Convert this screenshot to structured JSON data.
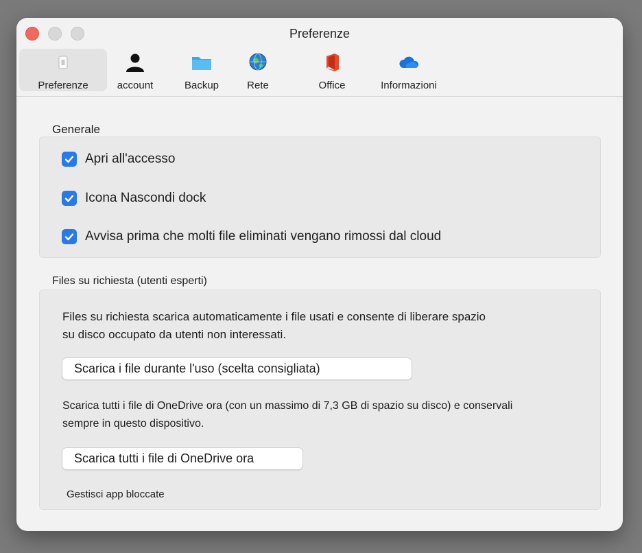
{
  "window": {
    "title": "Preferenze"
  },
  "tabs": [
    {
      "label": "Preferenze",
      "icon": "switch-icon",
      "active": true
    },
    {
      "label": "account",
      "icon": "person-icon"
    },
    {
      "label": "Backup",
      "icon": "folder-icon"
    },
    {
      "label": "Rete",
      "icon": "globe-icon"
    },
    {
      "label": "Office",
      "icon": "office-icon"
    },
    {
      "label": "Informazioni",
      "icon": "cloud-icon"
    }
  ],
  "general": {
    "title": "Generale",
    "options": [
      {
        "label": "Apri all'accesso",
        "checked": true
      },
      {
        "label": "Icona Nascondi dock",
        "checked": true
      },
      {
        "label": "Avvisa prima che molti file eliminati vengano rimossi dal cloud",
        "checked": true
      }
    ]
  },
  "files_on_demand": {
    "title": "Files su richiesta (utenti esperti)",
    "description_line1": "Files su richiesta scarica automaticamente i file usati e consente di liberare spazio",
    "description_line2": "su disco occupato da utenti non interessati.",
    "download_on_use_button": "Scarica i file durante l'uso (scelta consigliata)",
    "download_all_description_line1": "Scarica tutti i file di OneDrive ora (con un massimo di 7,3 GB di spazio su disco) e conservali",
    "download_all_description_line2": "sempre in questo dispositivo.",
    "download_all_button": "Scarica tutti i file di OneDrive ora",
    "manage_blocked_apps_link": "Gestisci app bloccate"
  },
  "colors": {
    "checkbox": "#2a79e6",
    "close": "#ee6a5e",
    "office": "#e34b2b",
    "onedrive": "#1a73d9"
  }
}
